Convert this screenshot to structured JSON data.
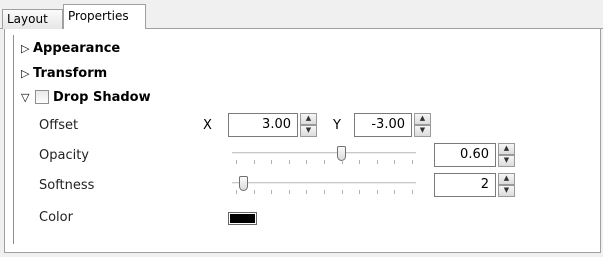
{
  "tabs": [
    {
      "label": "Layout",
      "active": false
    },
    {
      "label": "Properties",
      "active": true
    }
  ],
  "sections": {
    "appearance": {
      "label": "Appearance",
      "expanded": false,
      "icon": "triangle-right-icon"
    },
    "transform": {
      "label": "Transform",
      "expanded": false,
      "icon": "triangle-right-icon"
    },
    "drop_shadow": {
      "label": "Drop Shadow",
      "expanded": true,
      "checked": false,
      "icon": "triangle-down-icon"
    }
  },
  "drop_shadow": {
    "offset": {
      "label": "Offset",
      "x_label": "X",
      "x_value": "3.00",
      "y_label": "Y",
      "y_value": "-3.00"
    },
    "opacity": {
      "label": "Opacity",
      "value": "0.60",
      "slider_fraction": 0.6
    },
    "softness": {
      "label": "Softness",
      "value": "2",
      "slider_fraction": 0.04
    },
    "color": {
      "label": "Color",
      "swatch": "#000000"
    }
  },
  "icons": {
    "expanded": "▽",
    "collapsed": "▷",
    "spin_up": "▲",
    "spin_down": "▼"
  }
}
